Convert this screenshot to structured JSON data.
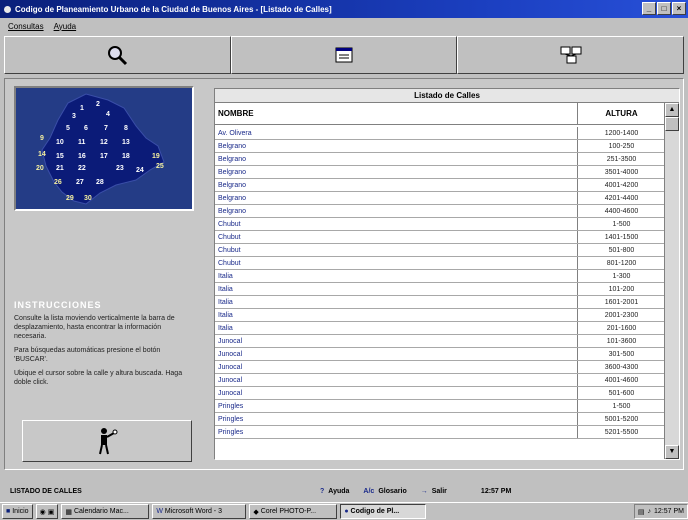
{
  "window": {
    "title": "Codigo de Planeamiento Urbano de la Ciudad de Buenos Aires - [Listado de Calles]"
  },
  "menu": {
    "items": [
      "Consultas",
      "Ayuda"
    ]
  },
  "toolbar": {
    "buttons": [
      {
        "icon": "magnifier-icon"
      },
      {
        "icon": "window-icon"
      },
      {
        "icon": "network-icon"
      }
    ]
  },
  "map": {
    "district_numbers": [
      "1",
      "2",
      "3",
      "4",
      "5",
      "6",
      "7",
      "8",
      "9",
      "10",
      "11",
      "12",
      "13",
      "14",
      "15",
      "16",
      "17",
      "18",
      "19",
      "20",
      "21",
      "22",
      "23",
      "24",
      "25",
      "26",
      "27",
      "28",
      "29",
      "30"
    ]
  },
  "instructions": {
    "heading": "INSTRUCCIONES",
    "p1": "Consulte la lista moviendo verticalmente la barra de desplazamiento, hasta encontrar la información necesaria.",
    "p2": "Para búsquedas automáticas presione el botón 'BUSCAR'.",
    "p3": "Ubique el cursor sobre la calle y altura buscada. Haga doble click."
  },
  "list": {
    "title": "Listado de Calles",
    "col_nombre": "NOMBRE",
    "col_altura": "ALTURA",
    "rows": [
      {
        "nombre": "Av. Olivera",
        "altura": "1200-1400"
      },
      {
        "nombre": "Belgrano",
        "altura": "100-250"
      },
      {
        "nombre": "Belgrano",
        "altura": "251-3500"
      },
      {
        "nombre": "Belgrano",
        "altura": "3501-4000"
      },
      {
        "nombre": "Belgrano",
        "altura": "4001-4200"
      },
      {
        "nombre": "Belgrano",
        "altura": "4201-4400"
      },
      {
        "nombre": "Belgrano",
        "altura": "4400-4600"
      },
      {
        "nombre": "Chubut",
        "altura": "1-500"
      },
      {
        "nombre": "Chubut",
        "altura": "1401-1500"
      },
      {
        "nombre": "Chubut",
        "altura": "501-800"
      },
      {
        "nombre": "Chubut",
        "altura": "801-1200"
      },
      {
        "nombre": "Italia",
        "altura": "1-300"
      },
      {
        "nombre": "Italia",
        "altura": "101-200"
      },
      {
        "nombre": "Italia",
        "altura": "1601-2001"
      },
      {
        "nombre": "Italia",
        "altura": "2001-2300"
      },
      {
        "nombre": "Italia",
        "altura": "201-1600"
      },
      {
        "nombre": "Junocal",
        "altura": "101-3600"
      },
      {
        "nombre": "Junocal",
        "altura": "301-500"
      },
      {
        "nombre": "Junocal",
        "altura": "3600-4300"
      },
      {
        "nombre": "Junocal",
        "altura": "4001-4600"
      },
      {
        "nombre": "Junocal",
        "altura": "501-600"
      },
      {
        "nombre": "Pringles",
        "altura": "1-500"
      },
      {
        "nombre": "Pringles",
        "altura": "5001-5200"
      },
      {
        "nombre": "Pringles",
        "altura": "5201-5500"
      }
    ]
  },
  "status": {
    "left": "LISTADO DE CALLES",
    "ayuda": "Ayuda",
    "glosario": "Glosario",
    "salir": "Salir",
    "clock": "12:57 PM"
  },
  "taskbar": {
    "start": "Inicio",
    "tasks": [
      "Calendario Mac...",
      "Microsoft Word - 3",
      "Corel PHOTO-P...",
      "Codigo de Pl..."
    ],
    "clock": "12:57 PM"
  }
}
